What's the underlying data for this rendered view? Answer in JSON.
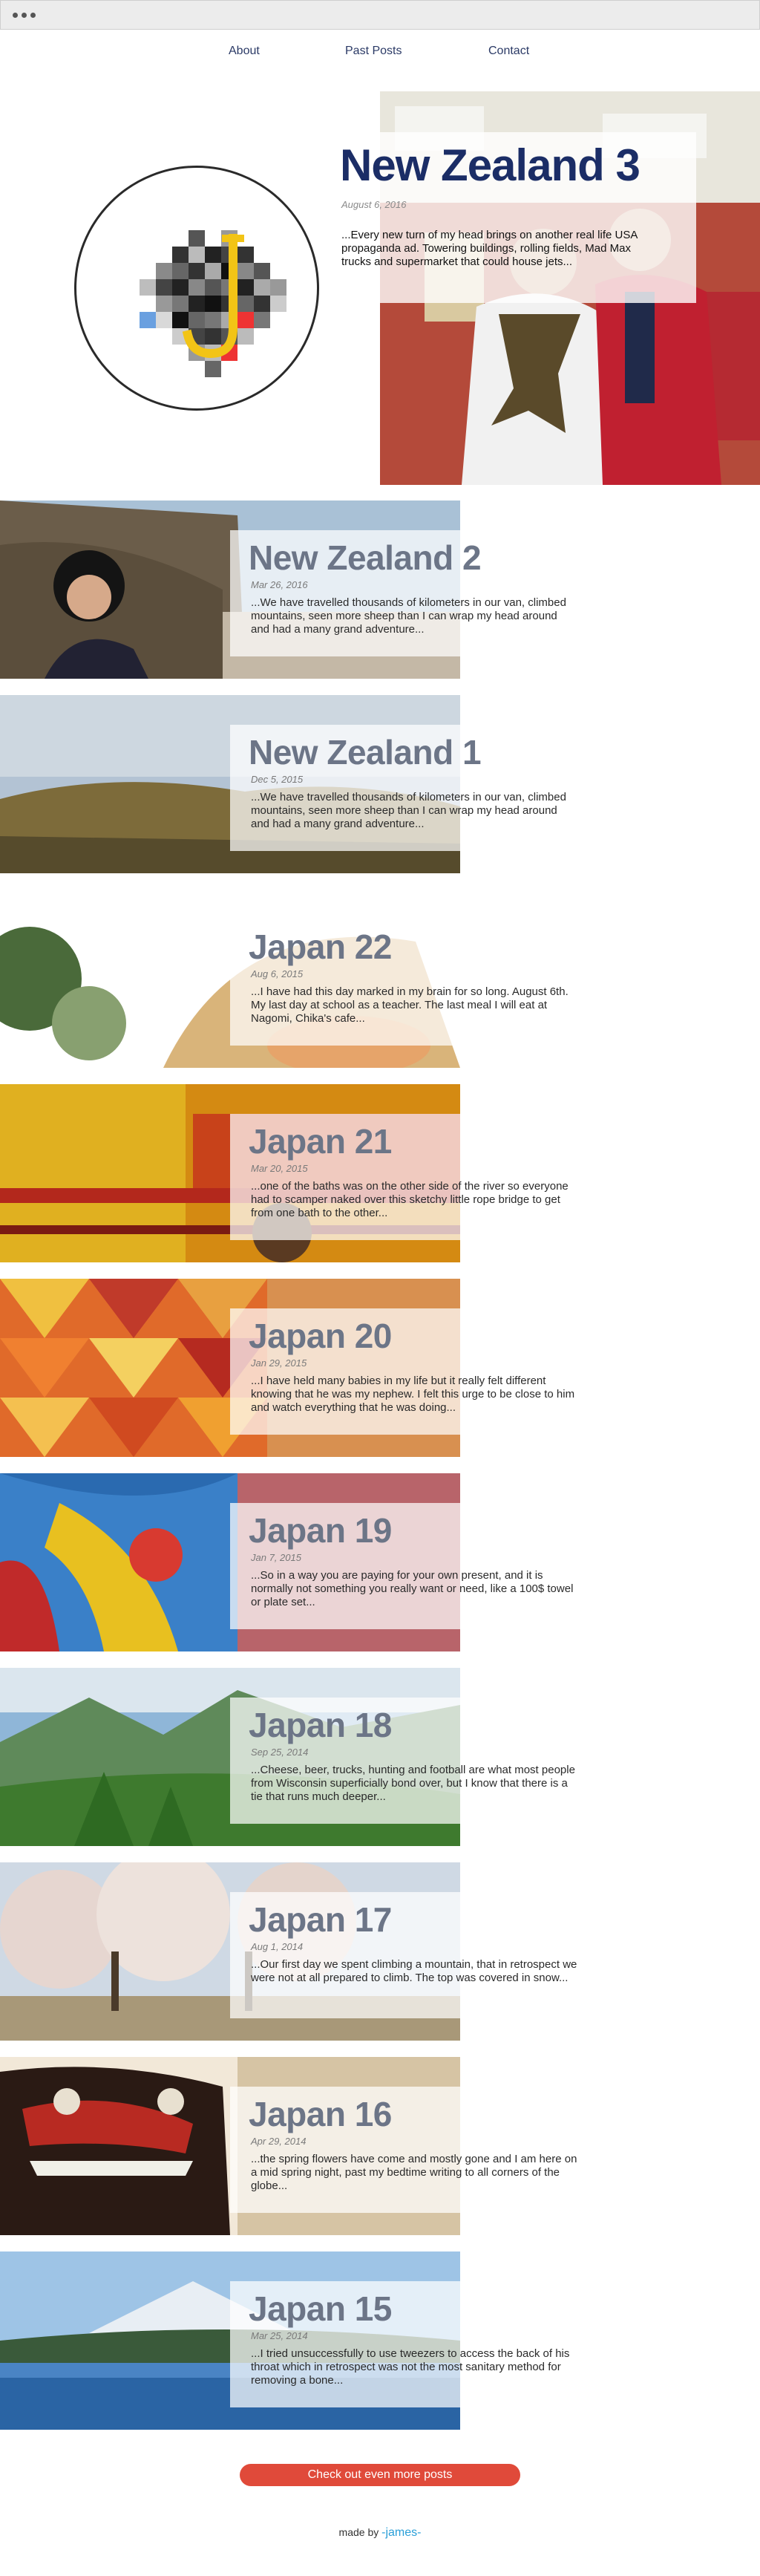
{
  "nav": {
    "items": [
      {
        "label": "About"
      },
      {
        "label": "Past Posts"
      },
      {
        "label": "Contact"
      }
    ]
  },
  "hero": {
    "title": "New Zealand 3",
    "date": "August 6, 2016",
    "excerpt": "...Every new turn of my head brings on another real life USA propaganda ad. Towering buildings, rolling fields, Mad Max trucks and supermarket that could house jets..."
  },
  "posts": [
    {
      "title": "New Zealand 2",
      "date": "Mar 26, 2016",
      "excerpt": "...We have travelled thousands of kilometers in our van, climbed mountains, seen more sheep than I can wrap my head around and had a many grand adventure..."
    },
    {
      "title": "New Zealand 1",
      "date": "Dec 5, 2015",
      "excerpt": "...We have travelled thousands of kilometers in our van, climbed mountains, seen more sheep than I can wrap my head around and had a many grand adventure..."
    },
    {
      "title": "Japan 22",
      "date": "Aug 6, 2015",
      "excerpt": "...I have had this day marked in my brain for so long. August 6th. My last day at school as a teacher. The last meal I will eat at Nagomi, Chika's cafe..."
    },
    {
      "title": "Japan 21",
      "date": "Mar 20, 2015",
      "excerpt": "...one of the baths was on the other side of the river so everyone had to scamper naked over this sketchy little rope bridge to get from one bath to the other..."
    },
    {
      "title": "Japan 20",
      "date": "Jan 29, 2015",
      "excerpt": "...I have held many babies in my life but it really felt different knowing that he was my nephew. I felt this urge to be close to him and watch everything that he was doing..."
    },
    {
      "title": "Japan 19",
      "date": "Jan 7, 2015",
      "excerpt": "...So in a way you are paying for your own present, and it is normally not something you really want or need, like a 100$ towel or plate set..."
    },
    {
      "title": "Japan 18",
      "date": "Sep 25, 2014",
      "excerpt": "...Cheese, beer, trucks, hunting and football are what most people from Wisconsin superficially bond over, but I know that there is a tie that runs much deeper..."
    },
    {
      "title": "Japan 17",
      "date": "Aug 1, 2014",
      "excerpt": "...Our first day we spent climbing a mountain, that in retrospect we were not at all prepared to climb. The top was covered in snow..."
    },
    {
      "title": "Japan 16",
      "date": "Apr 29, 2014",
      "excerpt": "...the spring flowers have come and mostly gone and I am here on a mid spring night, past my bedtime writing to all corners of the globe..."
    },
    {
      "title": "Japan 15",
      "date": "Mar 25, 2014",
      "excerpt": "...I tried unsuccessfully to use tweezers to access the back of his throat which in retrospect was not the most sanitary method for removing a bone..."
    }
  ],
  "more_button": {
    "label": "Check out even more posts"
  },
  "footer": {
    "prefix": "made by",
    "author": "-james-"
  },
  "colors": {
    "title_blue": "#1b2d66",
    "nav": "#2b3a66",
    "button": "#e04a3a",
    "author": "#2a9fd8"
  }
}
